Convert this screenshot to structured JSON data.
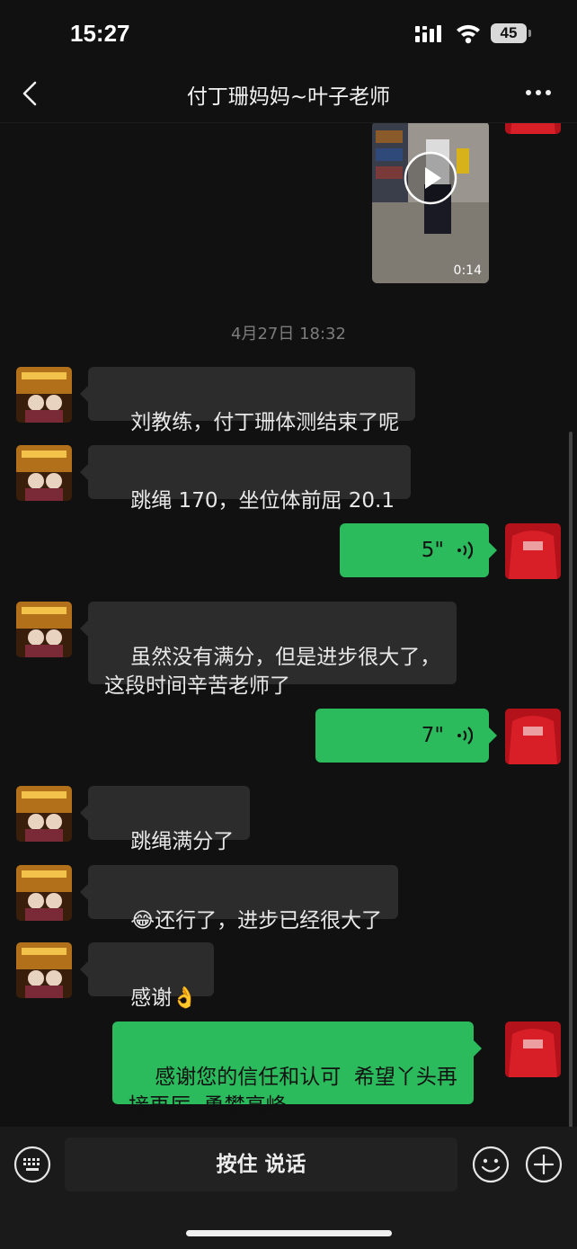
{
  "status": {
    "time": "15:27",
    "battery": "45"
  },
  "header": {
    "title": "付丁珊妈妈~叶子老师"
  },
  "video": {
    "duration": "0:14"
  },
  "timestamp": "4月27日 18:32",
  "messages": [
    {
      "text": "刘教练，付丁珊体测结束了呢"
    },
    {
      "text": "跳绳 170，坐位体前屈 20.1"
    },
    {
      "voice_duration": "5\""
    },
    {
      "text": "虽然没有满分，但是进步很大了，\n这段时间辛苦老师了"
    },
    {
      "voice_duration": "7\""
    },
    {
      "text": "跳绳满分了"
    },
    {
      "emoji": "😂",
      "text": "还行了，进步已经很大了"
    },
    {
      "text": "感谢",
      "emoji": "👌"
    },
    {
      "text": "感谢您的信任和认可  希望丫头再\n接再厉  勇攀高峰"
    }
  ],
  "input": {
    "talk_label": "按住 说话"
  },
  "icons": {
    "back": "chevron-left-icon",
    "more": "more-dots-icon",
    "keyboard": "keyboard-icon",
    "emoji": "smile-icon",
    "plus": "plus-icon",
    "voice": "voice-wave-icon",
    "play": "play-icon"
  },
  "colors": {
    "outgoing": "#2bba5c",
    "incoming": "#2c2c2c",
    "background": "#111111"
  }
}
